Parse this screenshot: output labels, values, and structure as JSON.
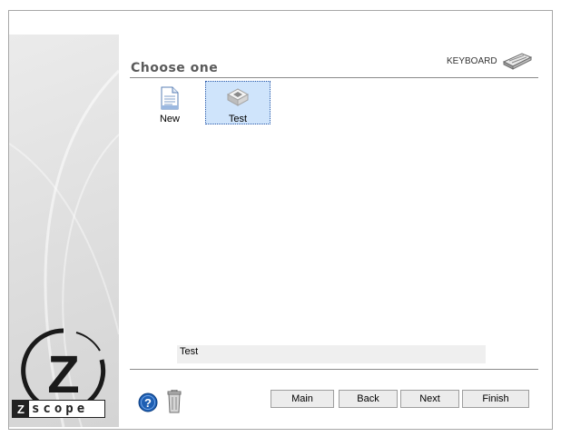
{
  "header": {
    "title": "Choose one",
    "keyboard_label": "KEYBOARD"
  },
  "items": [
    {
      "label": "New",
      "icon": "document-icon",
      "selected": false
    },
    {
      "label": "Test",
      "icon": "keyboard-key-icon",
      "selected": true
    }
  ],
  "status_text": "Test",
  "buttons": {
    "main": "Main",
    "back": "Back",
    "next": "Next",
    "finish": "Finish"
  },
  "logo": {
    "letter": "Z",
    "z_box": "Z",
    "word": "scope"
  },
  "colors": {
    "selection_bg": "#cfe4fb",
    "help_blue": "#1e5fb3"
  }
}
